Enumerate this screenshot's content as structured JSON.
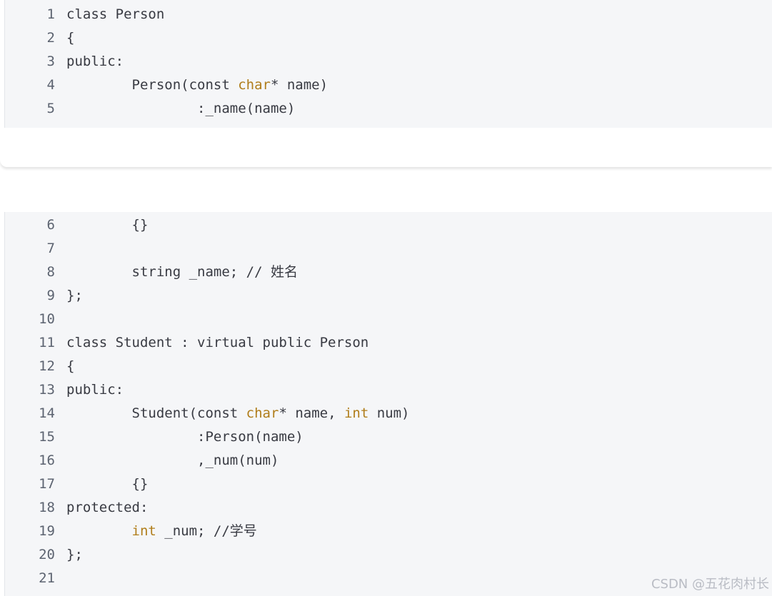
{
  "code_lines": [
    {
      "n": "1",
      "segs": [
        {
          "t": "class Person"
        }
      ]
    },
    {
      "n": "2",
      "segs": [
        {
          "t": "{"
        }
      ]
    },
    {
      "n": "3",
      "segs": [
        {
          "t": "public:"
        }
      ]
    },
    {
      "n": "4",
      "segs": [
        {
          "t": "        Person(const "
        },
        {
          "t": "char",
          "k": 1
        },
        {
          "t": "* name)"
        }
      ]
    },
    {
      "n": "5",
      "segs": [
        {
          "t": "                :_name(name)"
        }
      ]
    },
    {
      "n": "6",
      "segs": [
        {
          "t": "        {}"
        }
      ]
    },
    {
      "n": "7",
      "segs": []
    },
    {
      "n": "8",
      "segs": [
        {
          "t": "        string _name; // 姓名"
        }
      ]
    },
    {
      "n": "9",
      "segs": [
        {
          "t": "};"
        }
      ]
    },
    {
      "n": "10",
      "segs": []
    },
    {
      "n": "11",
      "segs": [
        {
          "t": "class Student : virtual public Person"
        }
      ]
    },
    {
      "n": "12",
      "segs": [
        {
          "t": "{"
        }
      ]
    },
    {
      "n": "13",
      "segs": [
        {
          "t": "public:"
        }
      ]
    },
    {
      "n": "14",
      "segs": [
        {
          "t": "        Student(const "
        },
        {
          "t": "char",
          "k": 1
        },
        {
          "t": "* name, "
        },
        {
          "t": "int",
          "k": 1
        },
        {
          "t": " num)"
        }
      ]
    },
    {
      "n": "15",
      "segs": [
        {
          "t": "                :Person(name)"
        }
      ]
    },
    {
      "n": "16",
      "segs": [
        {
          "t": "                ,_num(num)"
        }
      ]
    },
    {
      "n": "17",
      "segs": [
        {
          "t": "        {}"
        }
      ]
    },
    {
      "n": "18",
      "segs": [
        {
          "t": "protected:"
        }
      ]
    },
    {
      "n": "19",
      "segs": [
        {
          "t": "        "
        },
        {
          "t": "int",
          "k": 1
        },
        {
          "t": " _num; //学号"
        }
      ]
    },
    {
      "n": "20",
      "segs": [
        {
          "t": "};"
        }
      ]
    },
    {
      "n": "21",
      "segs": []
    }
  ],
  "watermark": "CSDN @五花肉村长",
  "colors": {
    "keyword": "#b07d1a",
    "text": "#383a42",
    "line_number": "#5c6370",
    "code_bg": "#f5f6f8"
  }
}
